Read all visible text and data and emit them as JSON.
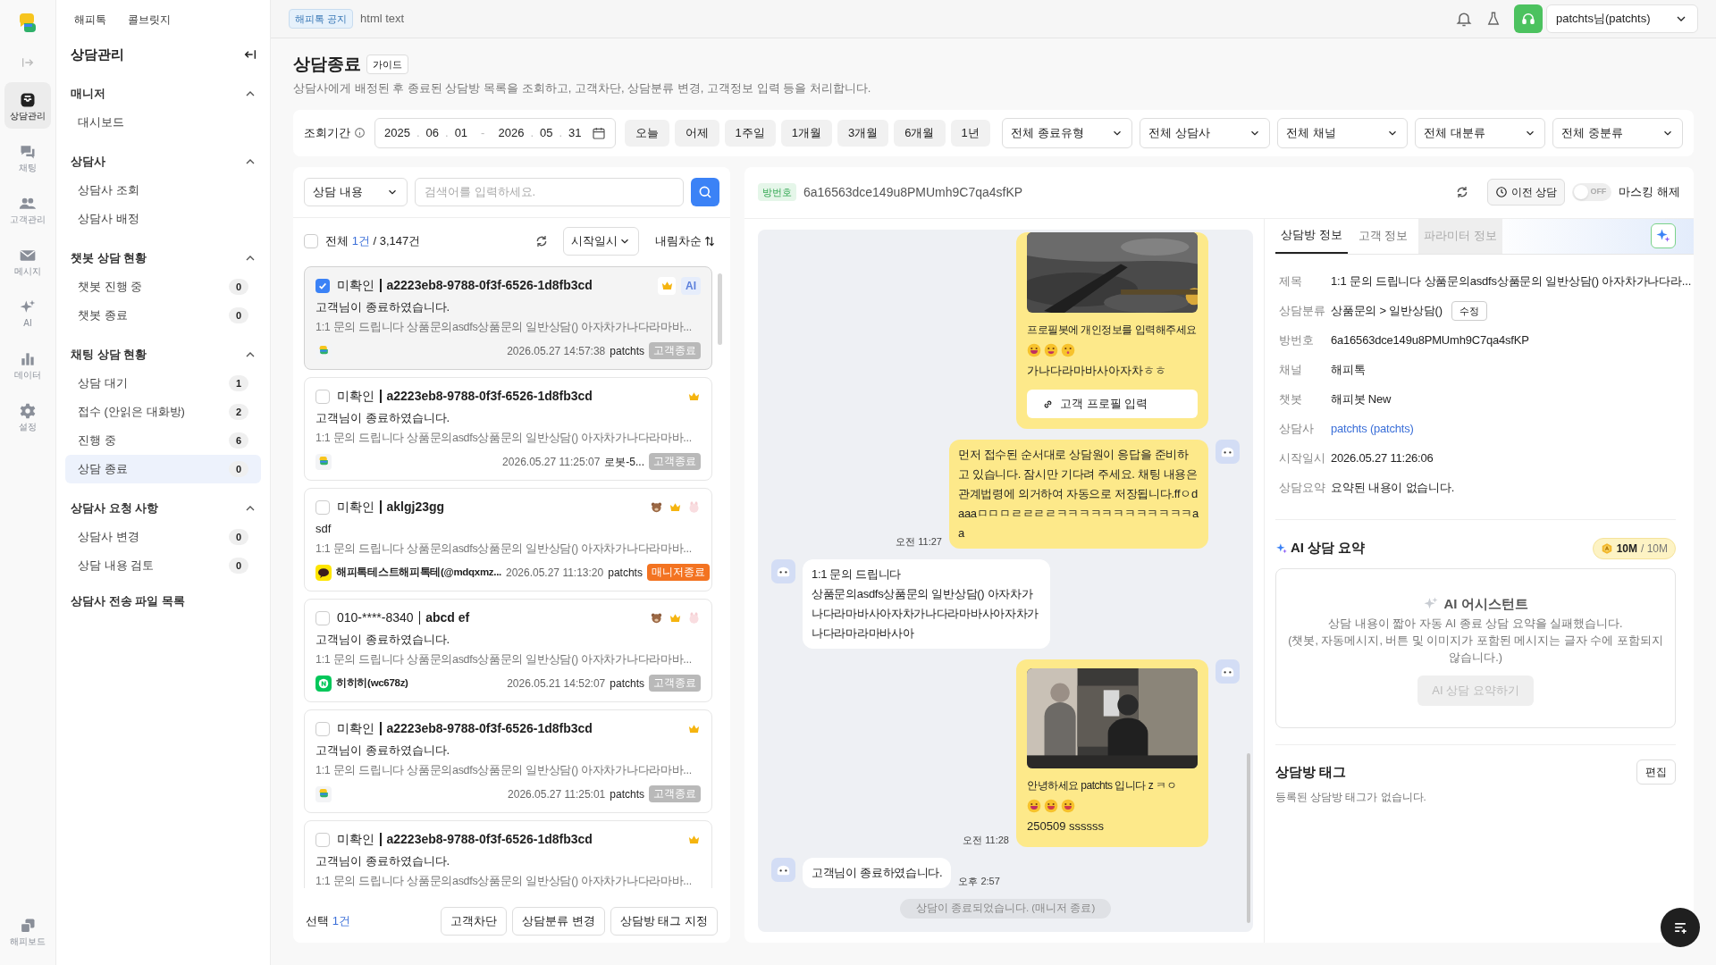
{
  "rail": {
    "items": [
      {
        "label": "상담관리",
        "selected": true
      },
      {
        "label": "채팅",
        "selected": false
      },
      {
        "label": "고객관리",
        "selected": false
      },
      {
        "label": "메시지",
        "selected": false
      },
      {
        "label": "AI",
        "selected": false
      },
      {
        "label": "데이터",
        "selected": false
      },
      {
        "label": "설정",
        "selected": false
      }
    ],
    "bottom": {
      "label": "해피보드"
    }
  },
  "sidebar": {
    "tabs": [
      {
        "label": "해피톡"
      },
      {
        "label": "콜브릿지"
      }
    ],
    "title": "상담관리",
    "sections": [
      {
        "title": "매니저",
        "expanded": true,
        "items": [
          {
            "label": "대시보드",
            "selected": false
          }
        ]
      },
      {
        "title": "상담사",
        "expanded": true,
        "items": [
          {
            "label": "상담사 조회",
            "selected": false
          },
          {
            "label": "상담사 배정",
            "selected": false
          }
        ]
      },
      {
        "title": "챗봇 상담 현황",
        "expanded": true,
        "items": [
          {
            "label": "챗봇 진행 중",
            "count": "0",
            "selected": false
          },
          {
            "label": "챗봇 종료",
            "count": "0",
            "selected": false
          }
        ]
      },
      {
        "title": "채팅 상담 현황",
        "expanded": true,
        "items": [
          {
            "label": "상담 대기",
            "count": "1",
            "selected": false
          },
          {
            "label": "접수 (안읽은 대화방)",
            "count": "2",
            "selected": false
          },
          {
            "label": "진행 중",
            "count": "6",
            "selected": false
          },
          {
            "label": "상담 종료",
            "count": "0",
            "selected": true
          }
        ]
      },
      {
        "title": "상담사 요청 사항",
        "expanded": true,
        "items": [
          {
            "label": "상담사 변경",
            "count": "0",
            "selected": false
          },
          {
            "label": "상담 내용 검토",
            "count": "0",
            "selected": false
          }
        ]
      }
    ],
    "footer_link": "상담사 전송 파일 목록"
  },
  "notice": {
    "badge": "해피톡 공지",
    "text": "html text"
  },
  "user": "patchts님(patchts)",
  "page": {
    "title": "상담종료",
    "guide": "가이드",
    "description": "상담사에게 배정된 후 종료된 상담방 목록을 조회하고, 고객차단, 상담분류 변경, 고객정보 입력 등을 처리합니다."
  },
  "filters": {
    "period_label": "조회기간",
    "start": {
      "year": "2025",
      "month": "06",
      "day": "01"
    },
    "end": {
      "year": "2026",
      "month": "05",
      "day": "31"
    },
    "date_dot": ".",
    "range_dash": "-",
    "quick": [
      "오늘",
      "어제",
      "1주일",
      "1개월",
      "3개월",
      "6개월",
      "1년"
    ],
    "selects": [
      "전체 종료유형",
      "전체 상담사",
      "전체 채널",
      "전체 대분류",
      "전체 중분류"
    ]
  },
  "search": {
    "scope": "상담 내용",
    "placeholder": "검색어를 입력하세요."
  },
  "list": {
    "all_checked": false,
    "all_label": "전체",
    "selected_count": "1건",
    "total": "/ 3,147건",
    "sort_field": "시작일시",
    "order": "내림차순",
    "items": [
      {
        "checked": true,
        "selected": true,
        "status": "미확인",
        "title": "a2223eb8-9788-0f3f-6526-1d8fb3cd",
        "badges": [
          {
            "kind": "crown"
          },
          {
            "kind": "ai",
            "label": "AI"
          }
        ],
        "last_message": "고객님이 종료하였습니다.",
        "preview": "1:1 문의 드립니다 상품문의asdfs상품문의 일반상담() 아자차가나다라마바...",
        "channel": {
          "kind": "happytalk"
        },
        "time": "2026.05.27 14:57:38",
        "agent": "patchts",
        "end": {
          "label": "고객종료",
          "kind": "customer"
        }
      },
      {
        "checked": false,
        "selected": false,
        "status": "미확인",
        "title": "a2223eb8-9788-0f3f-6526-1d8fb3cd",
        "badges": [
          {
            "kind": "crown"
          }
        ],
        "last_message": "고객님이 종료하였습니다.",
        "preview": "1:1 문의 드립니다 상품문의asdfs상품문의 일반상담() 아자차가나다라마바...",
        "channel": {
          "kind": "happytalk"
        },
        "time": "2026.05.27 11:25:07",
        "agent": "로봇-5...",
        "end": {
          "label": "고객종료",
          "kind": "customer"
        }
      },
      {
        "checked": false,
        "selected": false,
        "status": "미확인",
        "title": "aklgj23gg",
        "badges": [
          {
            "kind": "bear"
          },
          {
            "kind": "crown"
          },
          {
            "kind": "character"
          }
        ],
        "last_message": "sdf",
        "preview": "1:1 문의 드립니다 상품문의asdfs상품문의 일반상담() 아자차가나다라마바...",
        "channel": {
          "kind": "kakao"
        },
        "customer": "해피톡테스트해피톡테(@mdqxmz...",
        "time": "2026.05.27 11:13:20",
        "agent": "patchts",
        "end": {
          "label": "매니저종료",
          "kind": "manager"
        }
      },
      {
        "checked": false,
        "selected": false,
        "status": "010-****-8340",
        "title": "abcd ef",
        "badges": [
          {
            "kind": "bear"
          },
          {
            "kind": "crown"
          },
          {
            "kind": "character"
          }
        ],
        "last_message": "고객님이 종료하였습니다.",
        "preview": "1:1 문의 드립니다 상품문의asdfs상품문의 일반상담() 아자차가나다라마바...",
        "channel": {
          "kind": "naver"
        },
        "customer": "히히히(wc678z)",
        "time": "2026.05.21 14:52:07",
        "agent": "patchts",
        "end": {
          "label": "고객종료",
          "kind": "customer"
        }
      },
      {
        "checked": false,
        "selected": false,
        "status": "미확인",
        "title": "a2223eb8-9788-0f3f-6526-1d8fb3cd",
        "badges": [
          {
            "kind": "crown"
          }
        ],
        "last_message": "고객님이 종료하였습니다.",
        "preview": "1:1 문의 드립니다 상품문의asdfs상품문의 일반상담() 아자차가나다라마바...",
        "channel": {
          "kind": "happytalk"
        },
        "time": "2026.05.27 11:25:01",
        "agent": "patchts",
        "end": {
          "label": "고객종료",
          "kind": "customer"
        }
      },
      {
        "checked": false,
        "selected": false,
        "status": "미확인",
        "title": "a2223eb8-9788-0f3f-6526-1d8fb3cd",
        "badges": [
          {
            "kind": "crown"
          }
        ],
        "last_message": "고객님이 종료하였습니다.",
        "preview": "1:1 문의 드립니다 상품문의asdfs상품문의 일반상담() 아자차가나다라마바..."
      }
    ],
    "footer": {
      "label": "선택",
      "count": "1건",
      "buttons": [
        "고객차단",
        "상담분류 변경",
        "상담방 태그 지정"
      ]
    }
  },
  "chat": {
    "room_label": "방번호",
    "room_id": "6a16563dce149u8PMUmh9C7qa4sfKP",
    "history_button": "이전 상담",
    "masking": {
      "on": false,
      "toggle_label": "OFF",
      "label": "마스킹 해제"
    },
    "messages": [
      {
        "kind": "sent_card",
        "avatar": false,
        "image": {
          "kind": "picture"
        },
        "text": "프로필봇에 개인정보를 입력해주세요",
        "emojis": [
          {
            "kind": "grin"
          },
          {
            "kind": "wink"
          },
          {
            "kind": "kiss"
          }
        ],
        "text2": "가나다라마바사아자차ㅎㅎ",
        "button": "고객 프로필 입력"
      },
      {
        "kind": "sent_text",
        "avatar": true,
        "text": "먼저 접수된 순서대로 상담원이 응답을 준비하고 있습니다. 잠시만 기다려 주세요. 채팅 내용은 관계법령에 의거하여 자동으로 저장됩니다.ffㅇdaaaㅁㅁㅁㄹㄹㄹㄹㅋㅋㅋㅋㅋㅋㅋㅋㅋㅋㅋㅋaa",
        "time": "오전 11:27"
      },
      {
        "kind": "received_text",
        "avatar": true,
        "text": "1:1 문의 드립니다\n상품문의asdfs상품문의 일반상담() 아자차가나다라마바사아자차가나다라마바사아자차가나다라마라마바사아"
      },
      {
        "kind": "sent_card",
        "avatar": true,
        "image": {
          "kind": "picture"
        },
        "text": "안녕하세요 patchts 입니다 z ㅋㅇ",
        "emojis": [
          {
            "kind": "grin"
          },
          {
            "kind": "smile"
          },
          {
            "kind": "smile"
          }
        ],
        "text2": "250509 ssssss",
        "time": "오전 11:28"
      },
      {
        "kind": "received_text",
        "avatar": true,
        "text": "고객님이 종료하였습니다.",
        "time": "오후 2:57"
      },
      {
        "kind": "system",
        "text": "상담이 종료되었습니다. (매니저 종료)"
      }
    ]
  },
  "info": {
    "tabs": [
      {
        "label": "상담방 정보",
        "selected": true,
        "disabled": false
      },
      {
        "label": "고객 정보",
        "selected": false,
        "disabled": false
      },
      {
        "label": "파라미터 정보",
        "selected": false,
        "disabled": true
      }
    ],
    "rows": [
      {
        "label": "제목",
        "value": "1:1 문의 드립니다 상품문의asdfs상품문의 일반상담() 아자차가나다라..."
      },
      {
        "label": "상담분류",
        "value": "상품문의 > 일반상담()",
        "action": "수정"
      },
      {
        "label": "방번호",
        "value": "6a16563dce149u8PMUmh9C7qa4sfKP"
      },
      {
        "label": "채널",
        "value": "해피톡"
      },
      {
        "label": "챗봇",
        "value": "해피봇 New"
      },
      {
        "label": "상담사",
        "value": "patchts (patchts)",
        "kind": "link"
      },
      {
        "label": "시작일시",
        "value": "2026.05.27 11:26:06"
      },
      {
        "label": "상담요약",
        "value": "요약된 내용이 없습니다."
      }
    ],
    "ai": {
      "title": "AI 상담 요약",
      "quota_used": "10M",
      "quota_total": "/ 10M",
      "assistant": "AI 어시스턴트",
      "message": "상담 내용이 짧아 자동 AI 종료 상담 요약을 실패했습니다.",
      "note": "(챗봇, 자동메시지, 버튼 및 이미지가 포함된 메시지는 글자 수에 포함되지 않습니다.)",
      "button": "AI 상담 요약하기",
      "button_disabled": true
    },
    "tags": {
      "title": "상담방 태그",
      "edit": "편집",
      "empty": "등록된 상담방 태그가 없습니다."
    }
  }
}
